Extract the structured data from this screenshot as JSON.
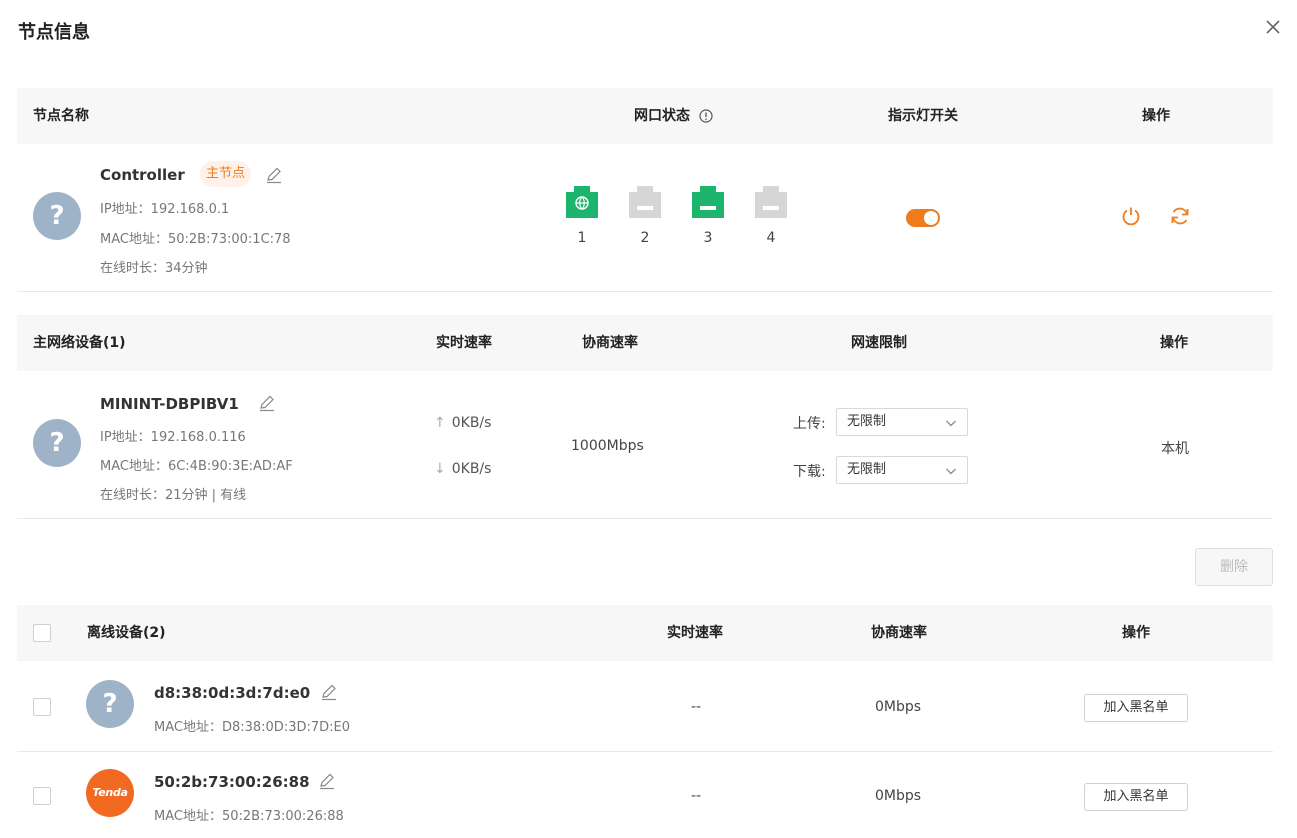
{
  "dialog": {
    "title": "节点信息"
  },
  "node_table": {
    "headers": {
      "name": "节点名称",
      "port_status": "网口状态",
      "led_switch": "指示灯开关",
      "operation": "操作"
    },
    "row": {
      "name": "Controller",
      "badge": "主节点",
      "ip": "IP地址：192.168.0.1",
      "mac": "MAC地址：50:2B:73:00:1C:78",
      "online": "在线时长：34分钟",
      "ports": [
        {
          "num": "1",
          "state": "wan-connected"
        },
        {
          "num": "2",
          "state": "disconnected"
        },
        {
          "num": "3",
          "state": "lan-connected"
        },
        {
          "num": "4",
          "state": "disconnected"
        }
      ],
      "led_on": true
    }
  },
  "main_devices": {
    "headers": {
      "name": "主网络设备(1)",
      "realtime": "实时速率",
      "negotiated": "协商速率",
      "limit": "网速限制",
      "operation": "操作"
    },
    "rows": [
      {
        "name": "MININT-DBPIBV1",
        "ip": "IP地址：192.168.0.116",
        "mac": "MAC地址：6C:4B:90:3E:AD:AF",
        "online": "在线时长：21分钟 | 有线",
        "up_rate": "0KB/s",
        "down_rate": "0KB/s",
        "negotiated": "1000Mbps",
        "upload_label": "上传:",
        "upload_value": "无限制",
        "download_label": "下载:",
        "download_value": "无限制",
        "operation": "本机"
      }
    ]
  },
  "actions": {
    "delete_label": "删除"
  },
  "offline_devices": {
    "headers": {
      "name": "离线设备(2)",
      "realtime": "实时速率",
      "negotiated": "协商速率",
      "operation": "操作"
    },
    "rows": [
      {
        "name": "d8:38:0d:3d:7d:e0",
        "mac": "MAC地址：D8:38:0D:3D:7D:E0",
        "realtime": "--",
        "negotiated": "0Mbps",
        "action": "加入黑名单",
        "avatar": "?"
      },
      {
        "name": "50:2b:73:00:26:88",
        "mac": "MAC地址：50:2B:73:00:26:88",
        "realtime": "--",
        "negotiated": "0Mbps",
        "action": "加入黑名单",
        "avatar": "Tenda"
      }
    ]
  },
  "colors": {
    "accent": "#f07b1d",
    "port_green": "#1db46e",
    "port_gray": "#d6d6d6",
    "avatar_gray": "#9fb3c8",
    "brand_orange": "#f26a22"
  }
}
